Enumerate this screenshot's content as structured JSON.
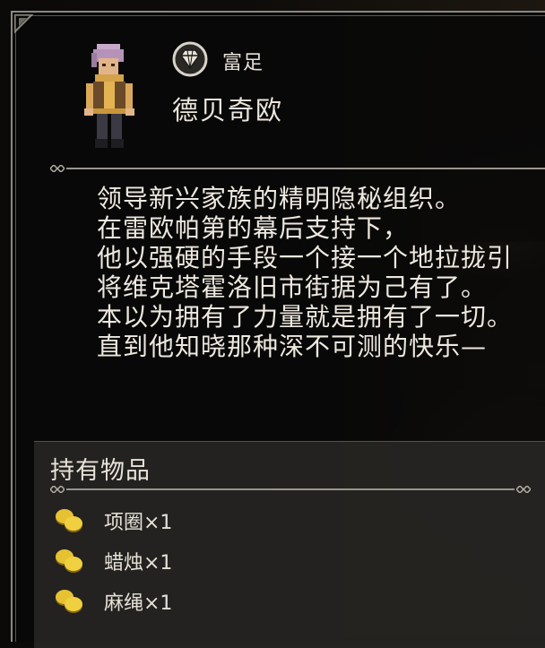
{
  "character": {
    "rank_label": "富足",
    "rank_icon": "diamond-emblem-icon",
    "name": "德贝奇欧"
  },
  "story": {
    "lines": [
      "领导新兴家族的精明隐秘组织。",
      "在雷欧帕第的幕后支持下，",
      "他以强硬的手段一个接一个地拉拢引",
      "将维克塔霍洛旧市街据为己有了。",
      "本以为拥有了力量就是拥有了一切。",
      "直到他知晓那种深不可测的快乐—"
    ]
  },
  "inventory": {
    "title": "持有物品",
    "items": [
      {
        "label": "项圈×1",
        "icon": "gold-coins-icon"
      },
      {
        "label": "蜡烛×1",
        "icon": "gold-coins-icon"
      },
      {
        "label": "麻绳×1",
        "icon": "gold-coins-icon"
      }
    ]
  },
  "colors": {
    "panel_bg": "#080808",
    "border": "#8c8880",
    "text": "#eee9df",
    "coin_gold": "#e6c233"
  }
}
